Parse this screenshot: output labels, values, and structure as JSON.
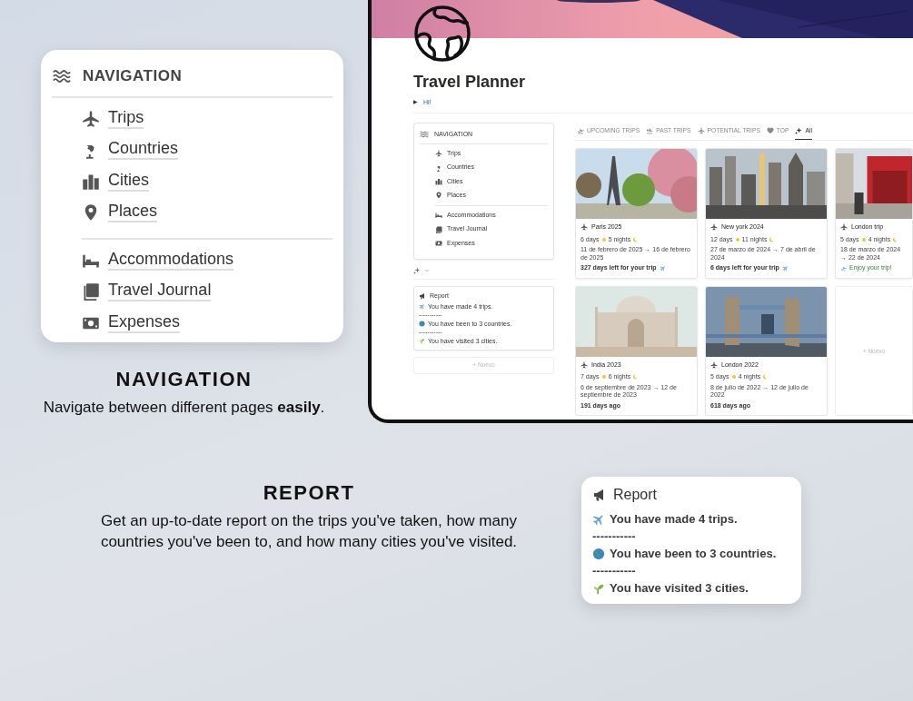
{
  "navigation_callout": {
    "title": "NAVIGATION",
    "groups": [
      [
        "Trips",
        "Countries",
        "Cities",
        "Places"
      ],
      [
        "Accommodations",
        "Travel Journal",
        "Expenses"
      ]
    ]
  },
  "navigation_feature": {
    "heading": "NAVIGATION",
    "caption": "Navigate between different pages **easily**."
  },
  "app": {
    "title": "Travel Planner",
    "toggle": {
      "arrow": "▶",
      "label": "Hi!"
    },
    "sidebar": {
      "navigation": {
        "title": "NAVIGATION",
        "groups": [
          [
            "Trips",
            "Countries",
            "Cities",
            "Places"
          ],
          [
            "Accommodations",
            "Travel Journal",
            "Expenses"
          ]
        ]
      },
      "report": {
        "title": "Report",
        "lines": [
          {
            "kind": "stat",
            "text": "You have made 4 trips."
          },
          {
            "kind": "separator",
            "text": "-----------"
          },
          {
            "kind": "stat",
            "text": "You have been to 3 countries."
          },
          {
            "kind": "separator",
            "text": "-----------"
          },
          {
            "kind": "stat",
            "text": "You have visited 3 cities."
          }
        ]
      },
      "new_button": "+ Nuevo"
    },
    "tabs": [
      {
        "label": "UPCOMING TRIPS",
        "selected": false
      },
      {
        "label": "PAST TRIPS",
        "selected": false
      },
      {
        "label": "POTENTIAL TRIPS",
        "selected": false
      },
      {
        "label": "TOP",
        "selected": false
      },
      {
        "label": "All",
        "selected": true
      }
    ],
    "cards": [
      {
        "kind": "trip",
        "title": "Paris 2025",
        "days": "6 days",
        "nights": "5 nights",
        "dates": "11 de febrero de 2025 → 16 de febrero de 2025",
        "status": {
          "kind": "countdown",
          "text": "327 days left for your trip"
        }
      },
      {
        "kind": "trip",
        "title": "New york 2024",
        "days": "12 days",
        "nights": "11 nights",
        "dates": "27 de marzo de 2024 → 7 de abril de 2024",
        "status": {
          "kind": "countdown",
          "text": "6 days left for your trip"
        }
      },
      {
        "kind": "trip",
        "title": "London trip",
        "days": "5 days",
        "nights": "4 nights",
        "dates": "18 de marzo de 2024 → 22 de 2024",
        "status": {
          "kind": "ongoing",
          "text": "Enjoy your trip!"
        }
      },
      {
        "kind": "trip",
        "title": "India 2023",
        "days": "7 days",
        "nights": "6 nights",
        "dates": "6 de septiembre de 2023 → 12 de septiembre de 2023",
        "status": {
          "kind": "past",
          "text": "191 days ago"
        }
      },
      {
        "kind": "trip",
        "title": "London 2022",
        "days": "5 days",
        "nights": "4 nights",
        "dates": "8 de julio de 2022 → 12 de julio de 2022",
        "status": {
          "kind": "past",
          "text": "618 days ago"
        }
      },
      {
        "kind": "new",
        "label": "+ Nuevo"
      }
    ]
  },
  "report_feature": {
    "heading": "REPORT",
    "caption": "Get an up-to-date report on the trips you've taken, how many countries you've been to, and how many cities you've visited."
  },
  "report_callout": {
    "title": "Report",
    "lines": [
      {
        "kind": "stat",
        "text": "You have made 4 trips."
      },
      {
        "kind": "separator",
        "text": "-----------"
      },
      {
        "kind": "stat",
        "text": "You have been to 3 countries."
      },
      {
        "kind": "separator",
        "text": "-----------"
      },
      {
        "kind": "stat",
        "text": "You have visited 3 cities."
      }
    ]
  }
}
